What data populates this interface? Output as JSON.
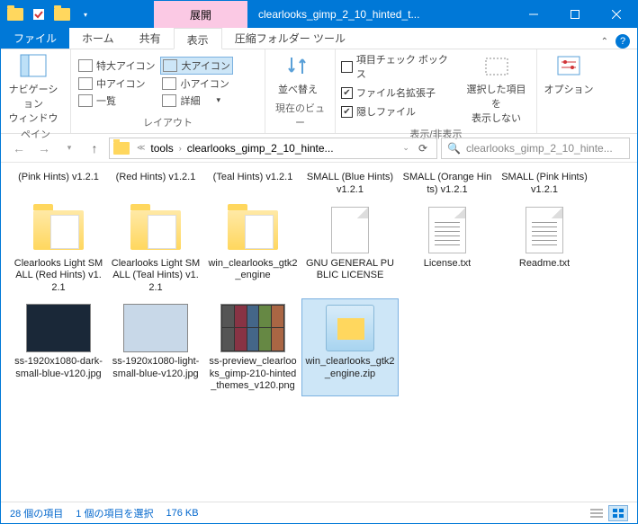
{
  "titlebar": {
    "context_label": "展開",
    "title": "clearlooks_gimp_2_10_hinted_t..."
  },
  "tabs": {
    "file": "ファイル",
    "home": "ホーム",
    "share": "共有",
    "view": "表示",
    "extract": "圧縮フォルダー ツール"
  },
  "ribbon": {
    "pane": {
      "nav": "ナビゲーション\nウィンドウ",
      "label": "ペイン"
    },
    "layout": {
      "xl": "特大アイコン",
      "l": "大アイコン",
      "m": "中アイコン",
      "s": "小アイコン",
      "list": "一覧",
      "detail": "詳細",
      "label": "レイアウト"
    },
    "current": {
      "sort": "並べ替え",
      "label": "現在のビュー"
    },
    "show": {
      "chk1": "項目チェック ボックス",
      "chk2": "ファイル名拡張子",
      "chk3": "隠しファイル",
      "hide": "選択した項目を\n表示しない",
      "label": "表示/非表示"
    },
    "options": {
      "btn": "オプション"
    }
  },
  "address": {
    "path1": "tools",
    "path2": "clearlooks_gimp_2_10_hinte...",
    "search_ph": "clearlooks_gimp_2_10_hinte..."
  },
  "files": {
    "row1": [
      "(Pink Hints) v1.2.1",
      "(Red Hints) v1.2.1",
      "(Teal Hints) v1.2.1",
      "SMALL (Blue Hints) v1.2.1",
      "SMALL (Orange Hints) v1.2.1",
      "SMALL (Pink Hints) v1.2.1"
    ],
    "row2": [
      "Clearlooks Light SMALL (Red Hints) v1.2.1",
      "Clearlooks Light SMALL (Teal Hints) v1.2.1",
      "win_clearlooks_gtk2_engine",
      "GNU GENERAL PUBLIC LICENSE",
      "License.txt",
      "Readme.txt"
    ],
    "row3": [
      "ss-1920x1080-dark-small-blue-v120.jpg",
      "ss-1920x1080-light-small-blue-v120.jpg",
      "ss-preview_clearlooks_gimp-210-hinted_themes_v120.png",
      "win_clearlooks_gtk2_engine.zip"
    ]
  },
  "status": {
    "count": "28 個の項目",
    "sel": "1 個の項目を選択",
    "size": "176 KB"
  }
}
